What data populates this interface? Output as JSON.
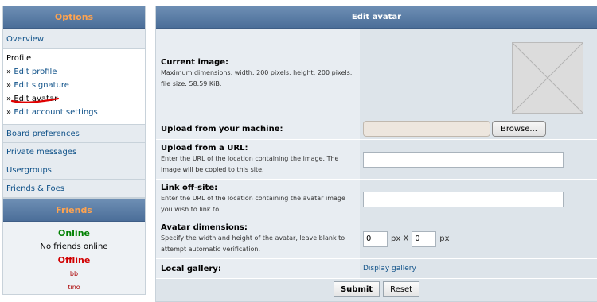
{
  "sidebar": {
    "title": "Options",
    "overview": "Overview",
    "profile": {
      "title": "Profile",
      "raquo": "»",
      "items": [
        "Edit profile",
        "Edit signature",
        "Edit avatar",
        "Edit account settings"
      ]
    },
    "sections": [
      "Board preferences",
      "Private messages",
      "Usergroups",
      "Friends & Foes"
    ]
  },
  "friends": {
    "title": "Friends",
    "online_heading": "Online",
    "online_text": "No friends online",
    "offline_heading": "Offline",
    "offline_list": [
      "bb",
      "tino"
    ]
  },
  "main": {
    "title": "Edit avatar",
    "current_image": {
      "label": "Current image:",
      "desc": "Maximum dimensions: width: 200 pixels, height: 200 pixels, file size: 58.59 KiB."
    },
    "upload": {
      "label": "Upload from your machine:",
      "browse": "Browse..."
    },
    "url": {
      "label": "Upload from a URL:",
      "desc": "Enter the URL of the location containing the image. The image will be copied to this site.",
      "value": ""
    },
    "link": {
      "label": "Link off-site:",
      "desc": "Enter the URL of the location containing the avatar image you wish to link to.",
      "value": ""
    },
    "dimensions": {
      "label": "Avatar dimensions:",
      "desc": "Specify the width and height of the avatar, leave blank to attempt automatic verification.",
      "width": "0",
      "height": "0",
      "unit1": "px X",
      "unit2": "px"
    },
    "gallery": {
      "label": "Local gallery:",
      "link": "Display gallery"
    },
    "submit": "Submit",
    "reset": "Reset"
  },
  "colors": {
    "header_gradient_top": "#6d8eb4",
    "header_gradient_bottom": "#4b6e99",
    "sidebar_title": "#ffa34f",
    "link": "#105289",
    "online": "#008000",
    "offline": "#d10000"
  }
}
